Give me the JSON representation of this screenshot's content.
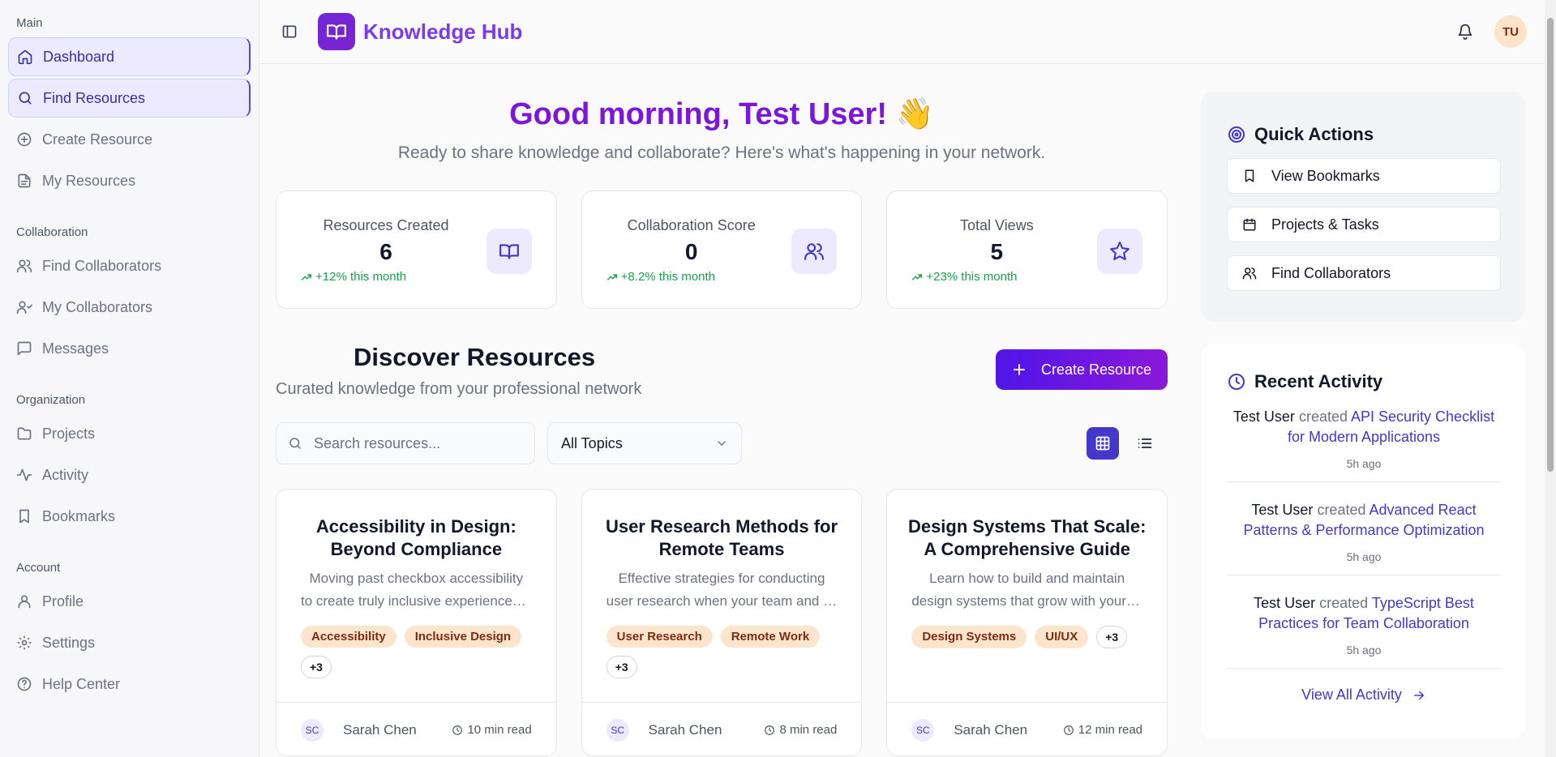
{
  "sidebar": {
    "groups": [
      {
        "label": "Main",
        "items": [
          {
            "label": "Dashboard",
            "icon": "home-icon",
            "active": true
          },
          {
            "label": "Find Resources",
            "icon": "search-icon",
            "active": true
          },
          {
            "label": "Create Resource",
            "icon": "plus-circle-icon"
          },
          {
            "label": "My Resources",
            "icon": "file-icon"
          }
        ]
      },
      {
        "label": "Collaboration",
        "items": [
          {
            "label": "Find Collaborators",
            "icon": "users-icon"
          },
          {
            "label": "My Collaborators",
            "icon": "user-group-icon"
          },
          {
            "label": "Messages",
            "icon": "message-icon"
          }
        ]
      },
      {
        "label": "Organization",
        "items": [
          {
            "label": "Projects",
            "icon": "folder-icon"
          },
          {
            "label": "Activity",
            "icon": "activity-icon"
          },
          {
            "label": "Bookmarks",
            "icon": "bookmark-icon"
          }
        ]
      },
      {
        "label": "Account",
        "items": [
          {
            "label": "Profile",
            "icon": "user-icon"
          },
          {
            "label": "Settings",
            "icon": "gear-icon"
          },
          {
            "label": "Help Center",
            "icon": "help-icon"
          }
        ]
      }
    ]
  },
  "header": {
    "brand": "Knowledge Hub",
    "avatar_initials": "TU"
  },
  "hero": {
    "greeting": "Good morning, Test User! 👋",
    "subtitle": "Ready to share knowledge and collaborate? Here's what's happening in your network."
  },
  "stats": [
    {
      "label": "Resources Created",
      "value": "6",
      "trend": "+12% this month",
      "icon": "book-icon"
    },
    {
      "label": "Collaboration Score",
      "value": "0",
      "trend": "+8.2% this month",
      "icon": "users-icon"
    },
    {
      "label": "Total Views",
      "value": "5",
      "trend": "+23% this month",
      "icon": "star-icon"
    }
  ],
  "discover": {
    "title": "Discover Resources",
    "subtitle": "Curated knowledge from your professional network",
    "create_label": "Create Resource",
    "search_placeholder": "Search resources...",
    "topic_selected": "All Topics"
  },
  "resources": [
    {
      "title": "Accessibility in Design: Beyond Compliance",
      "desc_lines": [
        "Moving past checkbox accessibility",
        "to create truly inclusive experiences for all users"
      ],
      "tags": [
        "Accessibility",
        "Inclusive Design"
      ],
      "more": "+3",
      "author_initials": "SC",
      "author": "Sarah Chen",
      "read_time": "10 min read"
    },
    {
      "title": "User Research Methods for Remote Teams",
      "desc_lines": [
        "Effective strategies for conducting",
        "user research when your team and users are distributed"
      ],
      "tags": [
        "User Research",
        "Remote Work"
      ],
      "more": "+3",
      "author_initials": "SC",
      "author": "Sarah Chen",
      "read_time": "8 min read"
    },
    {
      "title": "Design Systems That Scale: A Comprehensive Guide",
      "desc_lines": [
        "Learn how to build and maintain",
        "design systems that grow with your organization"
      ],
      "tags": [
        "Design Systems",
        "UI/UX"
      ],
      "more": "+3",
      "author_initials": "SC",
      "author": "Sarah Chen",
      "read_time": "12 min read"
    }
  ],
  "quick_actions": {
    "title": "Quick Actions",
    "items": [
      {
        "label": "View Bookmarks",
        "icon": "bookmark-icon"
      },
      {
        "label": "Projects & Tasks",
        "icon": "calendar-icon"
      },
      {
        "label": "Find Collaborators",
        "icon": "users-icon"
      }
    ]
  },
  "recent_activity": {
    "title": "Recent Activity",
    "items": [
      {
        "user": "Test User",
        "verb": "created",
        "target": "API Security Checklist for Modern Applications",
        "time": "5h ago"
      },
      {
        "user": "Test User",
        "verb": "created",
        "target": "Advanced React Patterns & Performance Optimization",
        "time": "5h ago"
      },
      {
        "user": "Test User",
        "verb": "created",
        "target": "TypeScript Best Practices for Team Collaboration",
        "time": "5h ago"
      }
    ],
    "view_all": "View All Activity"
  },
  "colors": {
    "brand": "#7c3aed",
    "accent": "#4338ca",
    "trend": "#16a34a",
    "tag_bg": "#fde4cc"
  }
}
